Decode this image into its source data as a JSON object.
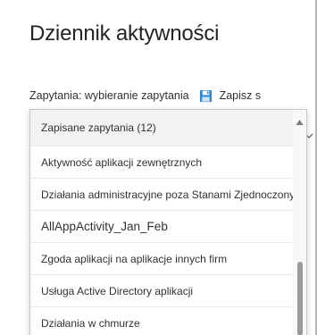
{
  "page": {
    "title": "Dziennik aktywności"
  },
  "query": {
    "label": "Zapytania: wybieranie zapytania",
    "save_label": "Zapisz s"
  },
  "dropdown": {
    "items": [
      {
        "label": "Zapisane zapytania (12)",
        "selected": true
      },
      {
        "label": "Aktywność aplikacji zewnętrznych"
      },
      {
        "label": "Działania administracyjne poza Stanami Zjednoczonymi"
      },
      {
        "label": "AllAppActivity_Jan_Feb"
      },
      {
        "label": "Zgoda aplikacji na aplikacje innych firm"
      },
      {
        "label": "Usługa Active Directory aplikacji"
      },
      {
        "label": "Działania w chmurze"
      }
    ]
  },
  "icons": {
    "save": "save-icon",
    "scroll_up": "chevron-up-icon",
    "dropdown_chevron": "chevron-down-icon"
  },
  "colors": {
    "save_icon": "#2b88d8",
    "selected_row": "#f3f2f1"
  }
}
